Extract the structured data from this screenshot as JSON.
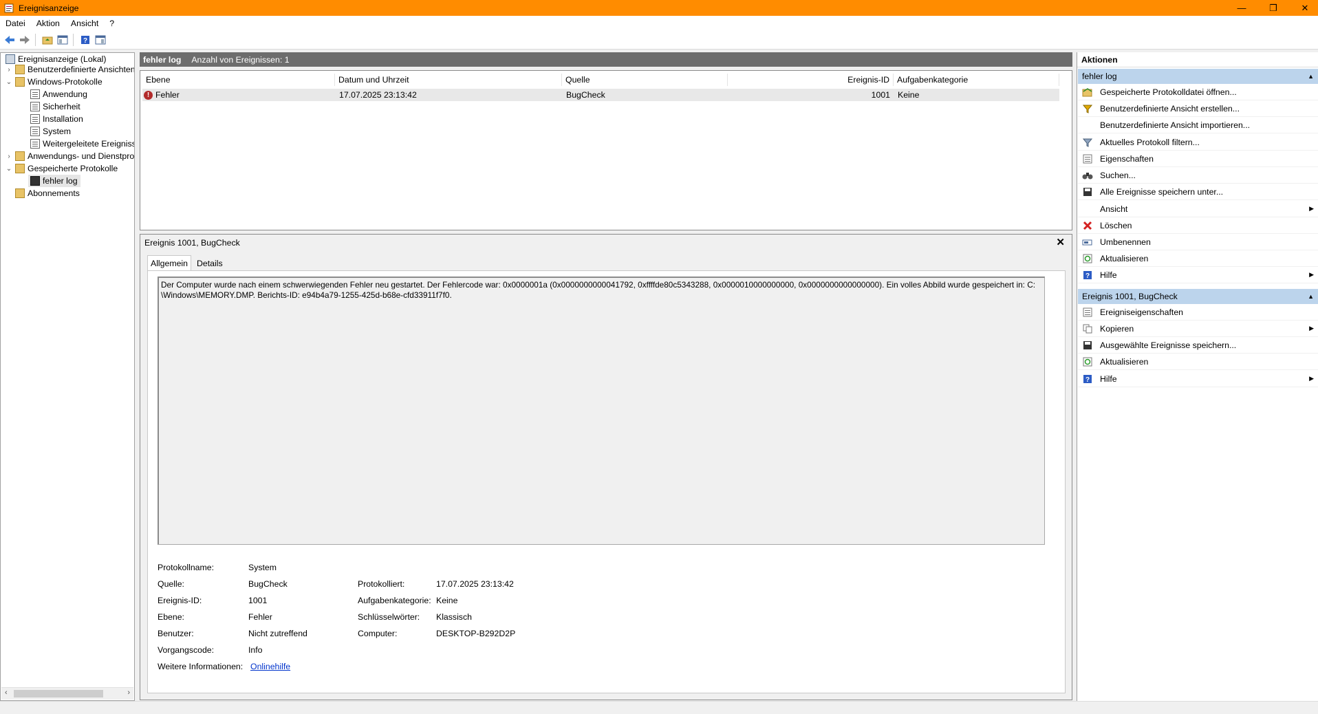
{
  "window": {
    "title": "Ereignisanzeige"
  },
  "menu": [
    "Datei",
    "Aktion",
    "Ansicht",
    "?"
  ],
  "tree": [
    {
      "label": "Ereignisanzeige (Lokal)"
    },
    {
      "label": "Benutzerdefinierte Ansichten"
    },
    {
      "label": "Windows-Protokolle"
    },
    {
      "label": "Anwendung"
    },
    {
      "label": "Sicherheit"
    },
    {
      "label": "Installation"
    },
    {
      "label": "System"
    },
    {
      "label": "Weitergeleitete Ereignisse"
    },
    {
      "label": "Anwendungs- und Dienstprotokolle"
    },
    {
      "label": "Gespeicherte Protokolle"
    },
    {
      "label": "fehler log"
    },
    {
      "label": "Abonnements"
    }
  ],
  "center": {
    "log_name": "fehler log",
    "event_count": "Anzahl von Ereignissen: 1",
    "columns": [
      "Ebene",
      "Datum und Uhrzeit",
      "Quelle",
      "Ereignis-ID",
      "Aufgabenkategorie"
    ],
    "rows": [
      {
        "level": "Fehler",
        "datetime": "17.07.2025 23:13:42",
        "source": "BugCheck",
        "event_id": "1001",
        "category": "Keine"
      }
    ]
  },
  "detail": {
    "title": "Ereignis 1001, BugCheck",
    "tabs": [
      "Allgemein",
      "Details"
    ],
    "message_line1": "Der Computer wurde nach einem schwerwiegenden Fehler neu gestartet. Der Fehlercode war: 0x0000001a (0x0000000000041792, 0xffffde80c5343288, 0x0000010000000000, 0x0000000000000000). Ein volles Abbild wurde gespeichert in: C:",
    "message_line2": "\\Windows\\MEMORY.DMP. Berichts-ID: e94b4a79-1255-425d-b68e-cfd33911f7f0.",
    "fields": {
      "protokollname_label": "Protokollname:",
      "protokollname": "System",
      "quelle_label": "Quelle:",
      "quelle": "BugCheck",
      "protokolliert_label": "Protokolliert:",
      "protokolliert": "17.07.2025 23:13:42",
      "ereignis_id_label": "Ereignis-ID:",
      "ereignis_id": "1001",
      "aufgabenkategorie_label": "Aufgabenkategorie:",
      "aufgabenkategorie": "Keine",
      "ebene_label": "Ebene:",
      "ebene": "Fehler",
      "schluesselwoerter_label": "Schlüsselwörter:",
      "schluesselwoerter": "Klassisch",
      "benutzer_label": "Benutzer:",
      "benutzer": "Nicht zutreffend",
      "computer_label": "Computer:",
      "computer": "DESKTOP-B292D2P",
      "vorgangscode_label": "Vorgangscode:",
      "vorgangscode": "Info",
      "weitere_label": "Weitere Informationen:",
      "weitere_link": "Onlinehilfe"
    }
  },
  "actions": {
    "header": "Aktionen",
    "section1": "fehler log",
    "section1_items": [
      "Gespeicherte Protokolldatei öffnen...",
      "Benutzerdefinierte Ansicht erstellen...",
      "Benutzerdefinierte Ansicht importieren...",
      "Aktuelles Protokoll filtern...",
      "Eigenschaften",
      "Suchen...",
      "Alle Ereignisse speichern unter...",
      "Ansicht",
      "Löschen",
      "Umbenennen",
      "Aktualisieren",
      "Hilfe"
    ],
    "section2": "Ereignis 1001, BugCheck",
    "section2_items": [
      "Ereigniseigenschaften",
      "Kopieren",
      "Ausgewählte Ereignisse speichern...",
      "Aktualisieren",
      "Hilfe"
    ]
  }
}
